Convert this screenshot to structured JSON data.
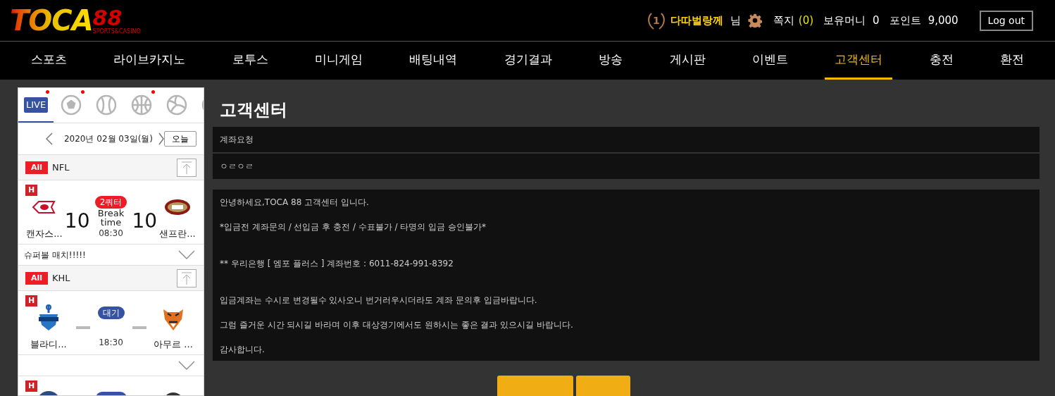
{
  "header": {
    "logo": {
      "wordmark": "TOCA",
      "number": "88",
      "tagline": "SPORTS&CASINO"
    },
    "user": {
      "rank": "1",
      "nickname": "다따벌랑께",
      "honorific": "님",
      "messages_label": "쪽지",
      "messages_count": "(0)",
      "money_label": "보유머니",
      "money": "0",
      "points_label": "포인트",
      "points": "9,000"
    },
    "logout": "Log out"
  },
  "nav": [
    {
      "label": "스포츠",
      "selected": false
    },
    {
      "label": "라이브카지노",
      "selected": false
    },
    {
      "label": "로투스",
      "selected": false
    },
    {
      "label": "미니게임",
      "selected": false
    },
    {
      "label": "배팅내역",
      "selected": false
    },
    {
      "label": "경기결과",
      "selected": false
    },
    {
      "label": "방송",
      "selected": false
    },
    {
      "label": "게시판",
      "selected": false
    },
    {
      "label": "이벤트",
      "selected": false
    },
    {
      "label": "고객센터",
      "selected": true
    },
    {
      "label": "충전",
      "selected": false
    },
    {
      "label": "환전",
      "selected": false
    }
  ],
  "sidebar": {
    "sport_tabs": [
      {
        "kind": "live",
        "label": "LIVE",
        "selected": true,
        "live_dot": true
      },
      {
        "kind": "soccer",
        "selected": false,
        "live_dot": true
      },
      {
        "kind": "baseball",
        "selected": false,
        "live_dot": false
      },
      {
        "kind": "basketball",
        "selected": false,
        "live_dot": true
      },
      {
        "kind": "volleyball",
        "selected": false,
        "live_dot": false
      },
      {
        "kind": "other",
        "selected": false
      }
    ],
    "date": "2020년 02월 03일(월)",
    "today_button": "오늘",
    "leagues": [
      {
        "badge": "All",
        "name": "NFL",
        "games": [
          {
            "hot": "H",
            "home": {
              "name": "캔자스...",
              "logo": {
                "kind": "arrowhead"
              }
            },
            "away": {
              "name": "샌프란...",
              "logo": {
                "kind": "oval"
              }
            },
            "home_score": "10",
            "away_score": "10",
            "status": {
              "kind": "live",
              "label": "2쿼터"
            },
            "phase": "Break time",
            "time": "08:30",
            "note": "슈퍼볼 매치!!!!!"
          }
        ]
      },
      {
        "badge": "All",
        "name": "KHL",
        "games": [
          {
            "hot": "H",
            "home": {
              "name": "블라디...",
              "logo": {
                "kind": "anchor"
              }
            },
            "away": {
              "name": "아무르 ...",
              "logo": {
                "kind": "tiger"
              }
            },
            "status": {
              "kind": "waiting",
              "label": "대기"
            },
            "time": "18:30"
          },
          {
            "hot": "H",
            "home": {
              "logo": {
                "kind": "round"
              }
            },
            "away": {
              "logo": {
                "kind": "dark"
              }
            },
            "status": {
              "kind": "waiting"
            }
          }
        ]
      }
    ]
  },
  "main": {
    "title": "고객센터",
    "fields": [
      {
        "value": "계좌요청"
      },
      {
        "value": "ㅇㄹㅇㄹ"
      }
    ],
    "message": [
      {
        "text": "안녕하세요,TOCA 88 고객센터 입니다.",
        "gap_after": false
      },
      {
        "text": "*입금전 계좌문의 / 선입금 후 충전 / 수표불가 / 타명의 입금 승인불가*",
        "gap_after": true
      },
      {
        "text": "** 우리은행 [ 엠포 플러스 ] 계좌번호 : 6011-824-991-8392",
        "gap_after": true
      },
      {
        "text": "입금계좌는 수시로 변경될수 있사오니 번거러우시더라도 계좌 문의후 입금바랍니다.",
        "gap_after": false
      },
      {
        "text": "그럼 즐거운 시간 되시길 바라며 이후 대상경기에서도 원하시는 좋은 결과 있으시길 바랍니다.",
        "gap_after": false
      },
      {
        "text": "감사합니다."
      }
    ],
    "action_buttons": [
      {
        "kind": "wide"
      },
      {
        "kind": "narrow"
      }
    ]
  }
}
